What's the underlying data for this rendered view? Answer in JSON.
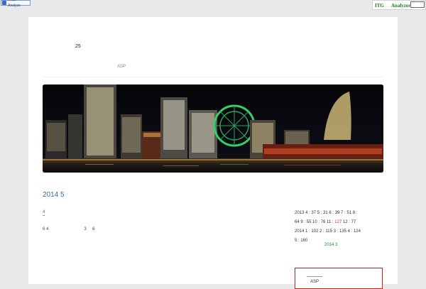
{
  "toolbar": {
    "ninja_label": "Ninja Analyze"
  },
  "badge": {
    "left": "ITG",
    "right": "Analyzer"
  },
  "header": {
    "count": "25",
    "nav_item": "ASP"
  },
  "post": {
    "title": "2014 5",
    "link": "4",
    "text": "6 4                              3     6"
  },
  "archive": {
    "row1_a": "2013  4 : 37   5 : 31   6 : 39   7 : 51   8 :",
    "row2_a": "64   9 : 55   10 : 76   11 : ",
    "row2_red": "127",
    "row2_b": "   12 : 77",
    "row3": "2014   1 : 102   2 : 115   3 : 135   4 : 124",
    "row4": "5 : 160",
    "more": "2014 3"
  },
  "redbox": {
    "text": "ASP"
  },
  "colors": {
    "title_blue": "#2e6f9e",
    "archive_red": "#c0392b",
    "green": "#1a8a1a",
    "box_red": "#cc1d1d"
  }
}
